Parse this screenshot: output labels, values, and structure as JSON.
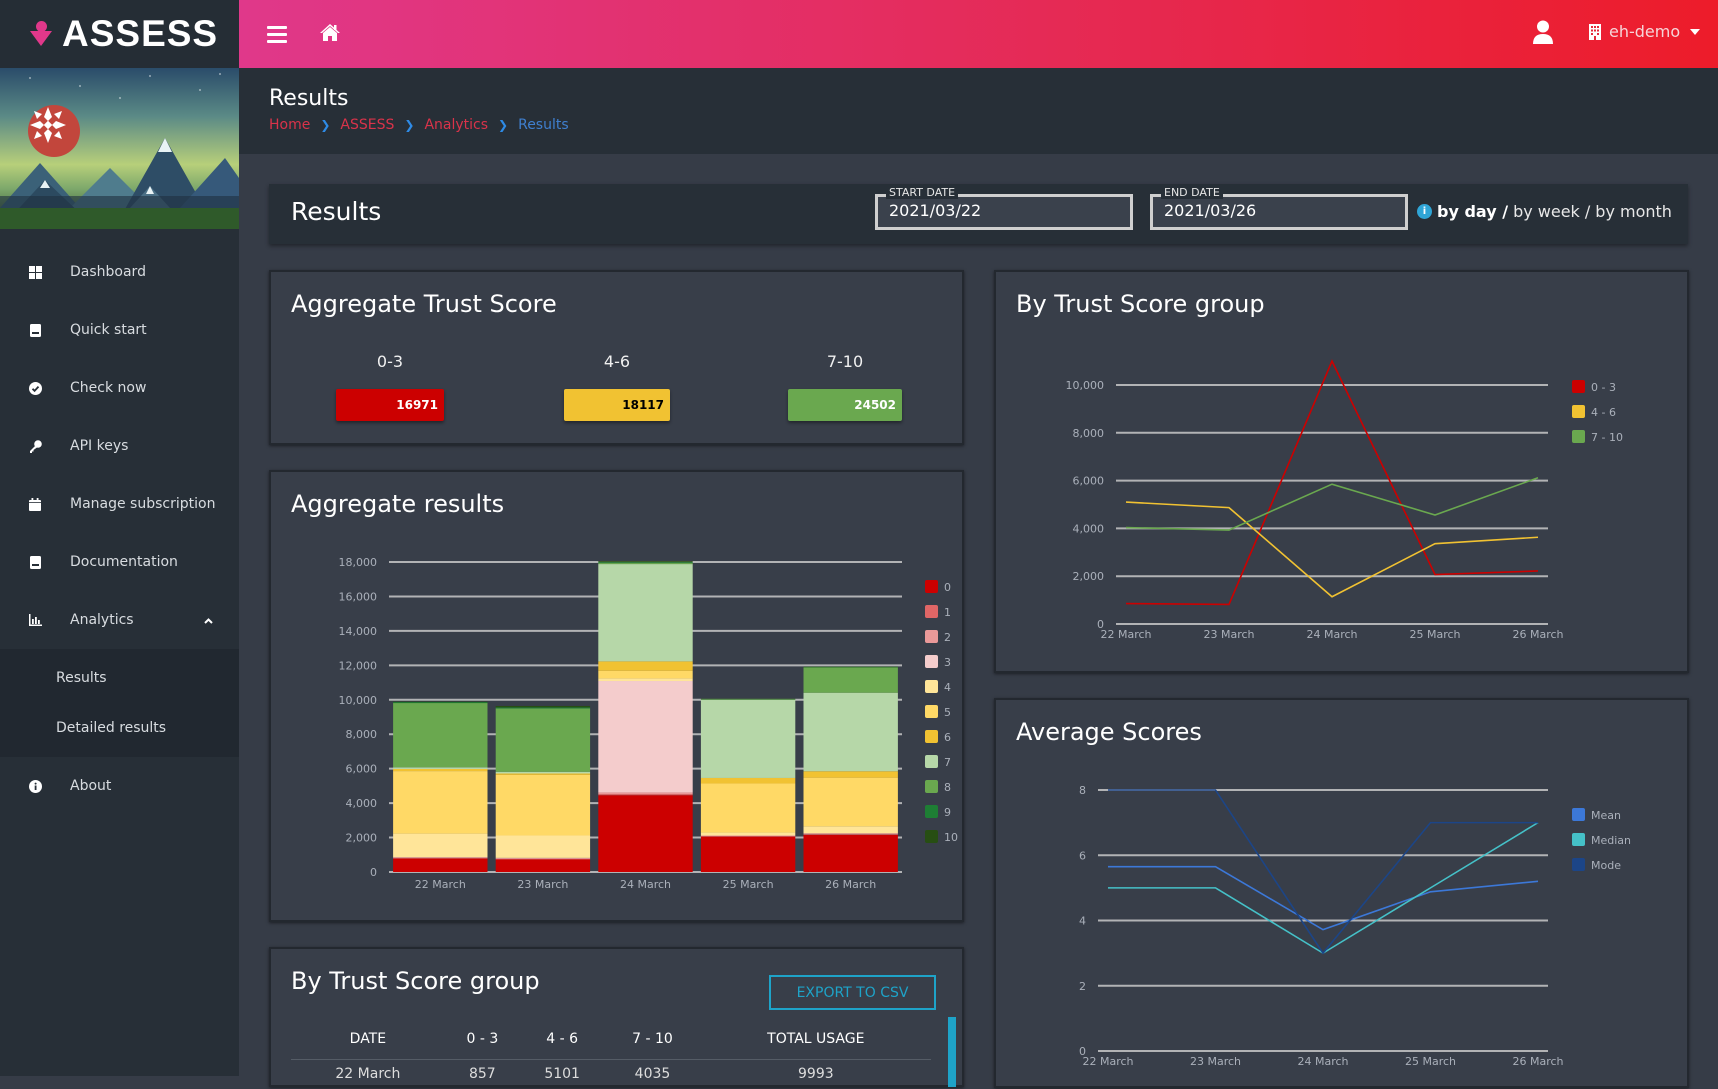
{
  "app": {
    "name": "ASSESS"
  },
  "topbar": {
    "org_name": "eh-demo"
  },
  "sidebar": {
    "items": [
      {
        "label": "Dashboard",
        "icon": "dashboard-icon"
      },
      {
        "label": "Quick start",
        "icon": "book-icon"
      },
      {
        "label": "Check now",
        "icon": "check-circle-icon"
      },
      {
        "label": "API keys",
        "icon": "key-icon"
      },
      {
        "label": "Manage subscription",
        "icon": "calendar-icon"
      },
      {
        "label": "Documentation",
        "icon": "book-icon"
      },
      {
        "label": "Analytics",
        "icon": "bar-chart-icon",
        "expanded": true
      },
      {
        "label": "About",
        "icon": "info-icon"
      }
    ],
    "analytics_sub": [
      {
        "label": "Results",
        "active": true
      },
      {
        "label": "Detailed results"
      }
    ]
  },
  "page": {
    "title": "Results",
    "breadcrumb": [
      "Home",
      "ASSESS",
      "Analytics",
      "Results"
    ]
  },
  "filter": {
    "title": "Results",
    "start_label": "START DATE",
    "start_value": "2021/03/22",
    "end_label": "END DATE",
    "end_value": "2021/03/26",
    "period_selected": "by day /",
    "period_week": "by week /",
    "period_month": "by month"
  },
  "trust_score": {
    "title": "Aggregate Trust Score",
    "groups": [
      {
        "label": "0-3",
        "value": "16971",
        "color": "#cc0000",
        "text_color": "#ffffff"
      },
      {
        "label": "4-6",
        "value": "18117",
        "color": "#f1c232",
        "text_color": "#000000"
      },
      {
        "label": "7-10",
        "value": "24502",
        "color": "#6aa84f",
        "text_color": "#ffffff"
      }
    ]
  },
  "table": {
    "title": "By Trust Score group",
    "export_label": "EXPORT TO CSV",
    "headers": [
      "DATE",
      "0 - 3",
      "4 - 6",
      "7 - 10",
      "TOTAL USAGE"
    ],
    "rows": [
      [
        "22 March",
        "857",
        "5101",
        "4035",
        "9993"
      ]
    ]
  },
  "chart_data": [
    {
      "id": "aggregate-results",
      "type": "bar",
      "stacked": true,
      "title": "Aggregate results",
      "categories": [
        "22 March",
        "23 March",
        "24 March",
        "25 March",
        "26 March"
      ],
      "ylim": [
        0,
        18000
      ],
      "yticks": [
        0,
        2000,
        4000,
        6000,
        8000,
        10000,
        12000,
        14000,
        16000,
        18000
      ],
      "ytick_labels": [
        "0",
        "2,000",
        "4,000",
        "6,000",
        "8,000",
        "10,000",
        "12,000",
        "14,000",
        "16,000",
        "18,000"
      ],
      "grid": true,
      "legend": "right",
      "series": [
        {
          "name": "0",
          "color": "#cc0000",
          "values": [
            780,
            740,
            4460,
            2060,
            2160
          ]
        },
        {
          "name": "1",
          "color": "#e06666",
          "values": [
            30,
            20,
            60,
            20,
            30
          ]
        },
        {
          "name": "2",
          "color": "#ea9999",
          "values": [
            50,
            60,
            100,
            40,
            60
          ]
        },
        {
          "name": "3",
          "color": "#f4cccc",
          "values": [
            0,
            0,
            6470,
            0,
            0
          ]
        },
        {
          "name": "4",
          "color": "#ffe599",
          "values": [
            1370,
            1300,
            150,
            170,
            400
          ]
        },
        {
          "name": "5",
          "color": "#ffd966",
          "values": [
            3630,
            3520,
            450,
            2850,
            2830
          ]
        },
        {
          "name": "6",
          "color": "#f1c232",
          "values": [
            120,
            80,
            540,
            320,
            370
          ]
        },
        {
          "name": "7",
          "color": "#b6d7a8",
          "values": [
            100,
            100,
            5650,
            4540,
            4560
          ]
        },
        {
          "name": "8",
          "color": "#6aa84f",
          "values": [
            3730,
            3680,
            60,
            30,
            1480
          ]
        },
        {
          "name": "9",
          "color": "#1e7e34",
          "values": [
            60,
            60,
            50,
            20,
            20
          ]
        },
        {
          "name": "10",
          "color": "#274e13",
          "values": [
            20,
            80,
            60,
            10,
            10
          ]
        }
      ]
    },
    {
      "id": "by-trust-score-group",
      "type": "line",
      "title": "By Trust Score group",
      "categories": [
        "22 March",
        "23 March",
        "24 March",
        "25 March",
        "26 March"
      ],
      "ylim": [
        0,
        10000
      ],
      "yticks": [
        0,
        2000,
        4000,
        6000,
        8000,
        10000
      ],
      "ytick_labels": [
        "0",
        "2,000",
        "4,000",
        "6,000",
        "8,000",
        "10,000"
      ],
      "grid": true,
      "legend": "right",
      "series": [
        {
          "name": "0 - 3",
          "color": "#cc0000",
          "values": [
            857,
            820,
            11000,
            2070,
            2220
          ]
        },
        {
          "name": "4 - 6",
          "color": "#f1c232",
          "values": [
            5101,
            4870,
            1140,
            3360,
            3630
          ]
        },
        {
          "name": "7 - 10",
          "color": "#6aa84f",
          "values": [
            4035,
            3930,
            5850,
            4560,
            6120
          ]
        }
      ]
    },
    {
      "id": "average-scores",
      "type": "line",
      "title": "Average Scores",
      "categories": [
        "22 March",
        "23 March",
        "24 March",
        "25 March",
        "26 March"
      ],
      "ylim": [
        0,
        8
      ],
      "yticks": [
        0,
        2,
        4,
        6,
        8
      ],
      "ytick_labels": [
        "0",
        "2",
        "4",
        "6",
        "8"
      ],
      "grid": true,
      "legend": "right",
      "series": [
        {
          "name": "Mean",
          "color": "#3c78d8",
          "values": [
            5.65,
            5.65,
            3.72,
            4.88,
            5.2
          ]
        },
        {
          "name": "Median",
          "color": "#45c1c8",
          "values": [
            5,
            5,
            3,
            5,
            7
          ]
        },
        {
          "name": "Mode",
          "color": "#1c4587",
          "values": [
            8,
            8,
            3,
            7,
            7
          ]
        }
      ]
    }
  ]
}
